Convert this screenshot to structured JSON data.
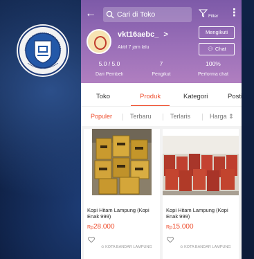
{
  "colors": {
    "accent": "#ee4d2d",
    "header_top": "#7d5aa8",
    "header_bottom": "#b07fc0",
    "background": "#13284f"
  },
  "logo": {
    "name": "university-seal-logo",
    "text": "STIKOM DARMAJAYA"
  },
  "header": {
    "back_icon": "back-arrow-icon",
    "search_placeholder": "Cari di Toko",
    "search_icon": "search-icon",
    "filter_label": "Filter",
    "filter_icon": "filter-funnel-icon",
    "more_icon": "more-vertical-icon"
  },
  "shop": {
    "name": "vkt16aebc_",
    "name_suffix": ">",
    "status": "Aktif 7 jam lalu",
    "follow_label": "Mengikuti",
    "chat_label": "Chat",
    "chat_icon": "chat-bubble-icon"
  },
  "stats": [
    {
      "value": "5.0 / 5.0",
      "label": "Dari Pembeli"
    },
    {
      "value": "7",
      "label": "Pengikut"
    },
    {
      "value": "100%",
      "label": "Performa chat"
    }
  ],
  "tabs": [
    {
      "label": "Toko"
    },
    {
      "label": "Produk",
      "active": true
    },
    {
      "label": "Kategori"
    },
    {
      "label": "Posti"
    }
  ],
  "sort": {
    "popular": "Populer",
    "newest": "Terbaru",
    "best_selling": "Terlaris",
    "price": "Harga ⇕"
  },
  "products": [
    {
      "title": "Kopi Hitam Lampung (Kopi Enak 999)",
      "currency": "Rp",
      "price": "28.000",
      "location": "KOTA BANDAR LAMPUNG"
    },
    {
      "title": "Kopi Hitam Lampung (Kopi Enak 999)",
      "currency": "Rp",
      "price": "15.000",
      "location": "KOTA BANDAR LAMPUNG"
    }
  ]
}
